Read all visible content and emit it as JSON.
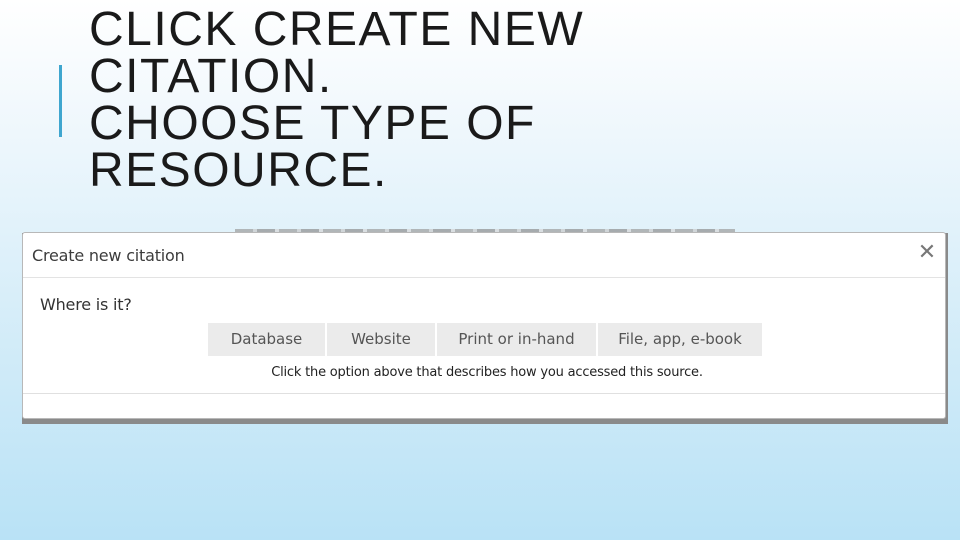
{
  "slide": {
    "title_lines": [
      "CLICK CREATE NEW",
      "CITATION.",
      "CHOOSE TYPE OF",
      "RESOURCE."
    ],
    "accent_color": "#3fa6cf"
  },
  "dialog": {
    "title": "Create new citation",
    "close_glyph": "✕",
    "close_icon": "close-icon",
    "question": "Where is it?",
    "options": [
      "Database",
      "Website",
      "Print or in-hand",
      "File, app, e-book"
    ],
    "hint": "Click the option above that describes how you accessed this source."
  }
}
